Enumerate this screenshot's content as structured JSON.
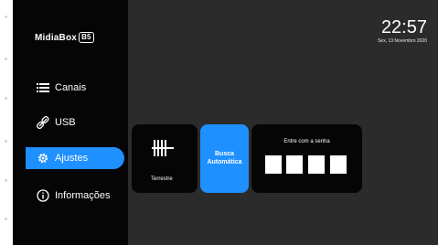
{
  "app": {
    "logo_text": "MidiaBox",
    "logo_badge": "B5"
  },
  "clock": {
    "time": "22:57",
    "date": "Sex, 13 Novembro 2020"
  },
  "sidebar": {
    "items": [
      {
        "label": "Canais",
        "icon": "list-icon",
        "active": false
      },
      {
        "label": "USB",
        "icon": "link-icon",
        "active": false
      },
      {
        "label": "Ajustes",
        "icon": "gear-icon",
        "active": true
      },
      {
        "label": "Informações",
        "icon": "info-icon",
        "active": false
      }
    ]
  },
  "cards": {
    "terrestre": {
      "label": "Terrestre",
      "icon": "antenna-icon"
    },
    "busca": {
      "label": "Busca Automática"
    },
    "senha": {
      "label": "Entre com a senha",
      "digits": 4
    }
  },
  "colors": {
    "accent": "#1e90ff",
    "background": "#2b2b2b",
    "sidebar": "#050505"
  }
}
